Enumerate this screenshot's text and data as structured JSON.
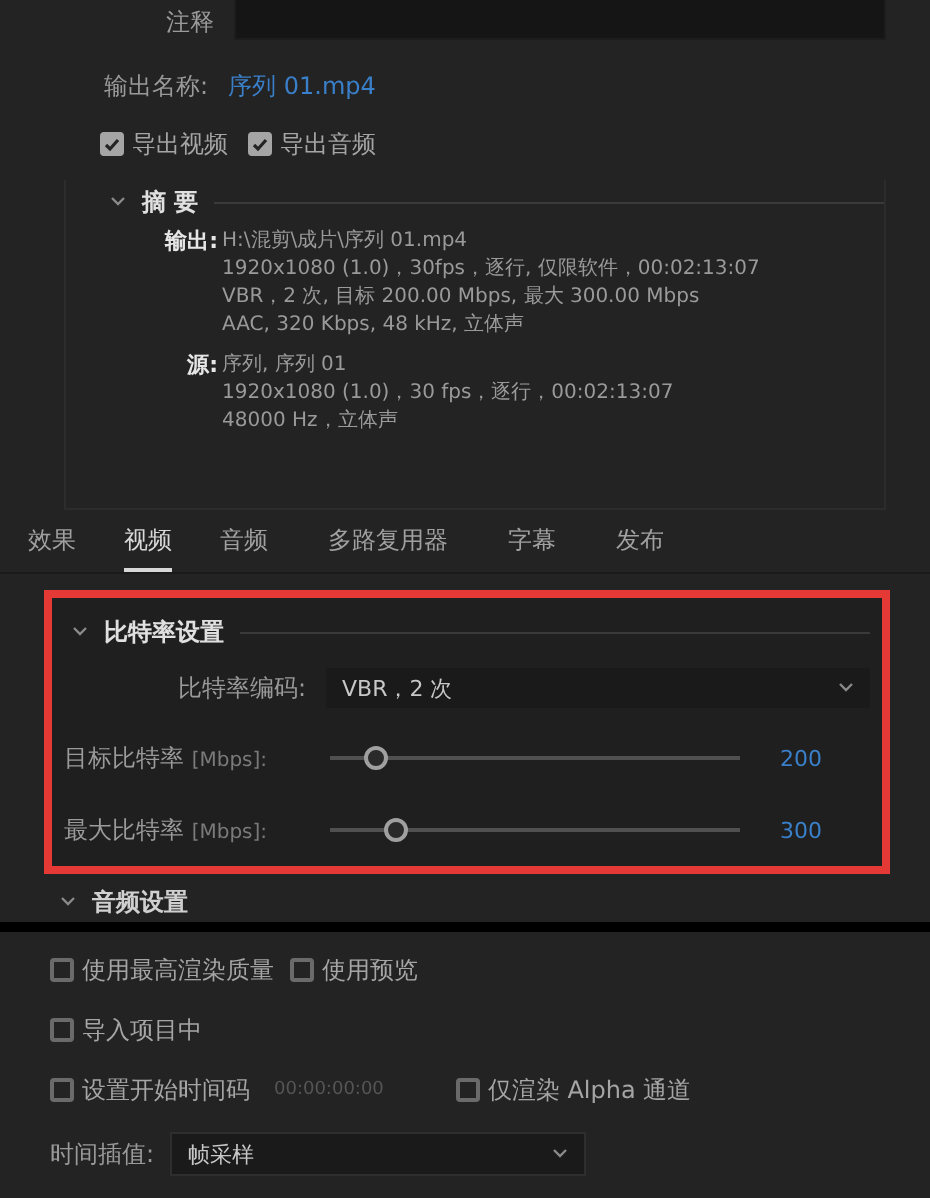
{
  "comment_field": {
    "label": "注释"
  },
  "output_name": {
    "label": "输出名称:",
    "value": "序列 01.mp4"
  },
  "export_options": [
    {
      "label": "导出视频",
      "checked": true
    },
    {
      "label": "导出音频",
      "checked": true
    }
  ],
  "summary": {
    "title": "摘 要",
    "expanded": true,
    "groups": [
      {
        "label": "输出:",
        "lines": [
          "H:\\混剪\\成片\\序列 01.mp4",
          "1920x1080 (1.0)，30fps，逐行, 仅限软件，00:02:13:07",
          "VBR，2 次, 目标 200.00 Mbps, 最大 300.00 Mbps",
          "AAC, 320 Kbps, 48  kHz, 立体声"
        ]
      },
      {
        "label": "源:",
        "lines": [
          "序列, 序列 01",
          "1920x1080 (1.0)，30 fps，逐行，00:02:13:07",
          "48000 Hz，立体声"
        ]
      }
    ]
  },
  "tabs": [
    {
      "label": "效果",
      "selected": false
    },
    {
      "label": "视频",
      "selected": true
    },
    {
      "label": "音频",
      "selected": false
    },
    {
      "label": "多路复用器",
      "selected": false
    },
    {
      "label": "字幕",
      "selected": false
    },
    {
      "label": "发布",
      "selected": false
    }
  ],
  "bitrate_section": {
    "title": "比特率设置",
    "expanded": true,
    "encoding": {
      "label": "比特率编码:",
      "value": "VBR，2 次"
    },
    "sliders": [
      {
        "label": "目标比特率",
        "unit": "[Mbps]:",
        "level": 0.11,
        "reading": "200"
      },
      {
        "label": "最大比特率",
        "unit": "[Mbps]:",
        "level": 0.16,
        "reading": "300"
      }
    ]
  },
  "audio_section": {
    "title": "音频设置",
    "expanded": true
  },
  "option_rows": [
    {
      "items": [
        {
          "label": "使用最高渲染质量",
          "checked": false
        },
        {
          "label": "使用预览",
          "checked": false
        }
      ]
    },
    {
      "items": [
        {
          "label": "导入项目中",
          "checked": false
        }
      ]
    },
    {
      "items": [
        {
          "label": "设置开始时间码",
          "checked": false,
          "timecode": "00:00:00:00"
        },
        {
          "label": "仅渲染 Alpha 通道",
          "checked": false
        }
      ]
    }
  ],
  "time_interpolation": {
    "label": "时间插值:",
    "value": "帧采样"
  }
}
